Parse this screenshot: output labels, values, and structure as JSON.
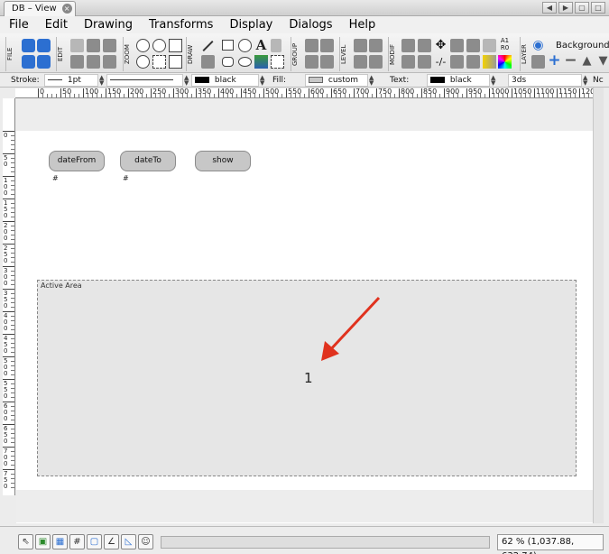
{
  "window": {
    "tab_title": "DB – View",
    "close": "×"
  },
  "menu": [
    "File",
    "Edit",
    "Drawing",
    "Transforms",
    "Display",
    "Dialogs",
    "Help"
  ],
  "toolbar": {
    "groups": [
      "FILE",
      "EDIT",
      "ZOOM",
      "DRAW",
      "GROUP",
      "LEVEL",
      "MODIF",
      "LAYER"
    ],
    "text_tool": "A",
    "a1r0": "A1\nR0",
    "background_label": "Background",
    "extra_label": "Nc"
  },
  "properties": {
    "stroke_label": "Stroke:",
    "stroke_width": "1pt",
    "stroke_color": "black",
    "fill_label": "Fill:",
    "fill_color": "custom",
    "text_label": "Text:",
    "text_color": "black",
    "font_size": "3ds"
  },
  "ruler": {
    "h_ticks": [
      "0",
      "50",
      "100",
      "150",
      "200",
      "250",
      "300",
      "350",
      "400",
      "450",
      "500",
      "550",
      "600",
      "650",
      "700",
      "750",
      "800",
      "850",
      "900",
      "950",
      "1000",
      "1050",
      "1100",
      "1150",
      "1200",
      "1250"
    ],
    "v_ticks": [
      "0",
      "50",
      "100",
      "150",
      "200",
      "250",
      "300",
      "350",
      "400",
      "450",
      "500",
      "550",
      "600",
      "650",
      "700",
      "750"
    ]
  },
  "canvas": {
    "buttons": [
      {
        "label": "dateFrom",
        "hash": "#"
      },
      {
        "label": "dateTo",
        "hash": "#"
      },
      {
        "label": "show",
        "hash": ""
      }
    ],
    "active_area_label": "Active Area",
    "active_area_value": "1"
  },
  "status": {
    "zoom": "62 % (1,037.88, 632.74)"
  },
  "colors": {
    "arrow": "#e0321e",
    "active_area_bg": "#e6e6e6",
    "button_bg": "#c7c7c7"
  }
}
